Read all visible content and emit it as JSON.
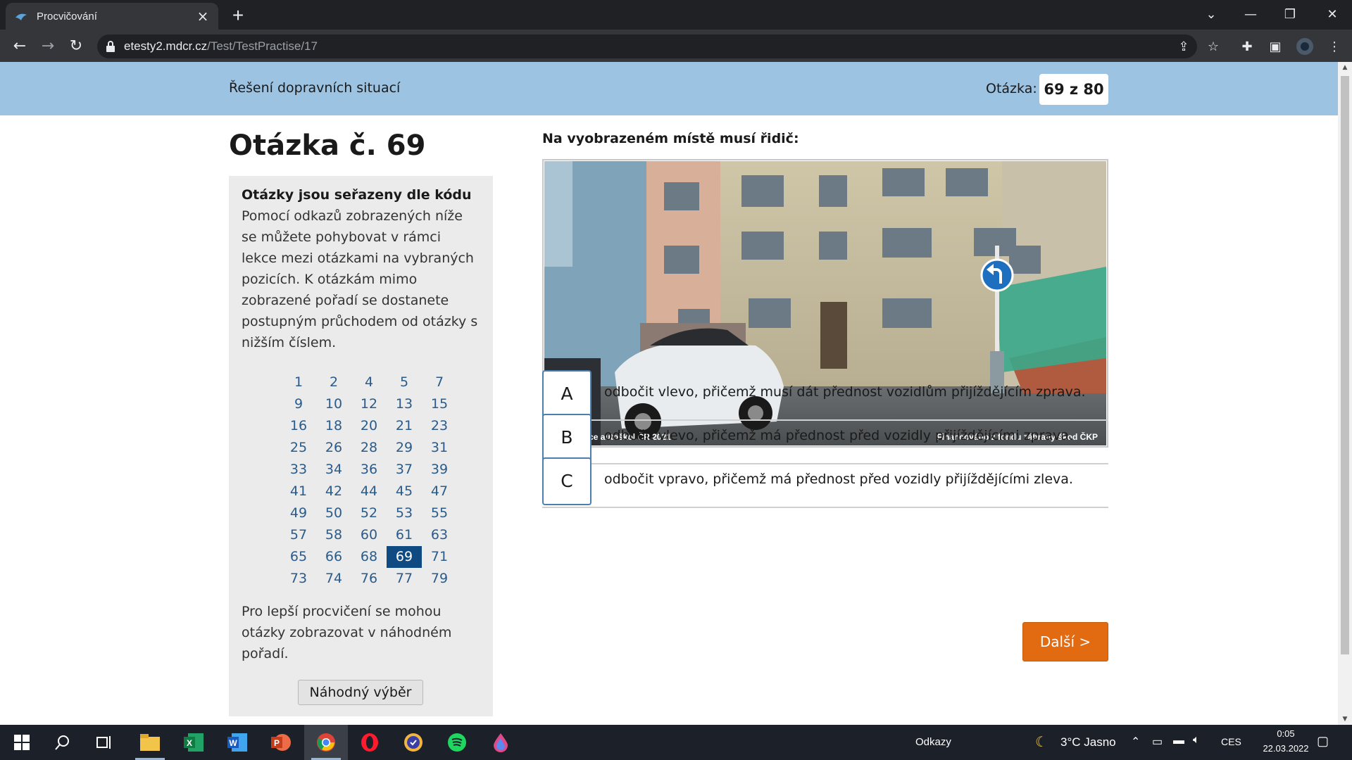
{
  "browser": {
    "tab_title": "Procvičování",
    "url_host": "etesty2.mdcr.cz",
    "url_path": "/Test/TestPractise/17"
  },
  "header": {
    "section_title": "Řešení dopravních situací",
    "question_label": "Otázka:",
    "question_counter": "69 z 80"
  },
  "main": {
    "heading": "Otázka č. 69",
    "question_text": "Na vyobrazeném místě musí řidič:",
    "photo_caption_left": "© Asociace autoškol ČR 2021",
    "photo_caption_right": "Financováno z fondu zábrany škod ČKP",
    "answers": [
      {
        "letter": "A",
        "text": "odbočit vlevo, přičemž musí dát přednost vozidlům přijíždějícím zprava."
      },
      {
        "letter": "B",
        "text": "odbočit vlevo, přičemž má přednost před vozidly přijíždějícími zprava."
      },
      {
        "letter": "C",
        "text": "odbočit vpravo, přičemž má přednost před vozidly přijíždějícími zleva."
      }
    ],
    "next_button": "Další >"
  },
  "sidebar": {
    "title": "Otázky jsou seřazeny dle kódu",
    "description": "Pomocí odkazů zobrazených níže se můžete pohybovat v rámci lekce mezi otázkami na vybraných pozicích. K otázkám mimo zobrazené pořadí se dostanete postupným průchodem od otázky s nižším číslem.",
    "question_numbers": [
      [
        "1",
        "2",
        "4",
        "5",
        "7"
      ],
      [
        "9",
        "10",
        "12",
        "13",
        "15"
      ],
      [
        "16",
        "18",
        "20",
        "21",
        "23"
      ],
      [
        "25",
        "26",
        "28",
        "29",
        "31"
      ],
      [
        "33",
        "34",
        "36",
        "37",
        "39"
      ],
      [
        "41",
        "42",
        "44",
        "45",
        "47"
      ],
      [
        "49",
        "50",
        "52",
        "53",
        "55"
      ],
      [
        "57",
        "58",
        "60",
        "61",
        "63"
      ],
      [
        "65",
        "66",
        "68",
        "69",
        "71"
      ],
      [
        "73",
        "74",
        "76",
        "77",
        "79"
      ]
    ],
    "active_number": "69",
    "random_text": "Pro lepší procvičení se mohou otázky zobrazovat v náhodném pořadí.",
    "random_button": "Náhodný výběr"
  },
  "taskbar": {
    "links_label": "Odkazy",
    "weather": "3°C Jasno",
    "language": "CES",
    "time": "0:05",
    "date": "22.03.2022"
  },
  "colors": {
    "header_band": "#9dc3e3",
    "active_cell": "#0f4a82",
    "next_button": "#e26a10",
    "link": "#2a5b8a"
  }
}
